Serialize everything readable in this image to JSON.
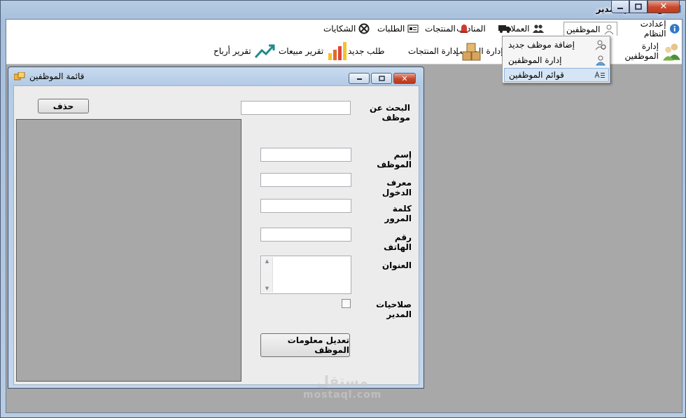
{
  "window": {
    "title": "لوحة تحكم المدير",
    "minimize_glyph": "▭",
    "maximize_glyph": "□",
    "close_glyph": "✕"
  },
  "menubar": {
    "items": [
      {
        "label": "إعدادت النظام",
        "icon": "info-icon"
      },
      {
        "label": "الموظفين",
        "icon": "user-icon"
      },
      {
        "label": "العملاء",
        "icon": "users-icon"
      },
      {
        "label": "المناديب",
        "icon": "truck-icon"
      },
      {
        "label": "المنتجات",
        "icon": "bell-icon"
      },
      {
        "label": "الطلبات",
        "icon": "form-icon"
      },
      {
        "label": "الشكايات",
        "icon": "circle-icon"
      }
    ]
  },
  "toolbar": {
    "items": [
      {
        "label": "إدارة الموظفين",
        "icon": "people-icon"
      },
      {
        "label": "إدارة المناديب",
        "icon": "cart-icon"
      },
      {
        "label": "إدارة المنتجات",
        "icon": "boxes-icon"
      },
      {
        "label": "طلب جديد",
        "icon": "new-order-icon"
      },
      {
        "label": "تقرير مبيعات",
        "icon": "bar-chart-icon"
      },
      {
        "label": "تقرير أرباح",
        "icon": "trend-icon"
      }
    ]
  },
  "dropdown": {
    "items": [
      {
        "label": "إضافة موظف جديد",
        "icon": "add-user-icon"
      },
      {
        "label": "إدارة الموظفين",
        "icon": "manage-users-icon"
      },
      {
        "label": "قوائم الموظفين",
        "icon": "list-icon"
      }
    ]
  },
  "child": {
    "title": "قائمة الموظفين",
    "delete_label": "حذف",
    "search_label": "البحث عن موظف",
    "name_label": "إسم الموظف",
    "login_label": "معرف الدخول",
    "password_label": "كلمة المرور",
    "phone_label": "رقم الهاتف",
    "address_label": "العنوان",
    "admin_label": "صلاحيات المدير",
    "update_label": "تعديل معلومات الموظف",
    "search_value": "",
    "name_value": "",
    "login_value": "",
    "password_value": "",
    "phone_value": ""
  },
  "watermark": {
    "arabic": "مستقل",
    "latin": "mostaql.com"
  },
  "colors": {
    "close_red": "#c7462a",
    "menu_highlight": "#d5e5f5",
    "grid_bg": "#a8a8a8"
  }
}
